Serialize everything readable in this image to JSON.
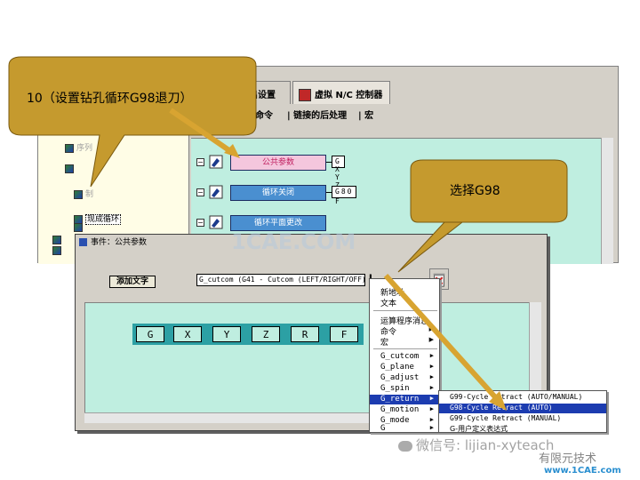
{
  "callouts": {
    "step": "10（设置钻孔循环G98退刀）",
    "select": "选择G98"
  },
  "back_window": {
    "tabs": [
      "出设置",
      "虚拟 N/C 控制器"
    ],
    "subtabs": [
      "命令",
      "链接的后处理",
      "宏"
    ],
    "tree": {
      "items": [
        {
          "label": "序列",
          "faded": true
        },
        {
          "label": "序列",
          "faded": true
        },
        {
          "label": "",
          "faded": true
        },
        {
          "label": "制",
          "faded": true
        },
        {
          "label": "现成循环",
          "faded": false,
          "selected": true
        },
        {
          "label": "",
          "faded": true
        }
      ]
    },
    "blocks": [
      {
        "label": "公共参数",
        "style": "pink",
        "value": "G X Y Z R F"
      },
      {
        "label": "循环关闭",
        "style": "blue",
        "value": "G80"
      },
      {
        "label": "循环平面更改",
        "style": "blue",
        "value": ""
      }
    ]
  },
  "dialog": {
    "title": "事件：公共参数",
    "add_text_button": "添加文字",
    "command_select": "G_cutcom (G41 - Cutcom (LEFT/RIGHT/OFF))",
    "words": [
      "G",
      "X",
      "Y",
      "Z",
      "R",
      "F"
    ]
  },
  "context_menu": {
    "items": [
      {
        "label": "新地址",
        "submenu": false
      },
      {
        "label": "文本",
        "submenu": false
      },
      {
        "label": "运算程序消息",
        "submenu": false
      },
      {
        "label": "命令",
        "submenu": true
      },
      {
        "label": "宏",
        "submenu": true
      },
      {
        "label": "G_cutcom",
        "submenu": true
      },
      {
        "label": "G_plane",
        "submenu": true
      },
      {
        "label": "G_adjust",
        "submenu": true
      },
      {
        "label": "G_spin",
        "submenu": true
      },
      {
        "label": "G_return",
        "submenu": true,
        "highlighted": true
      },
      {
        "label": "G_motion",
        "submenu": true
      },
      {
        "label": "G_mode",
        "submenu": true
      },
      {
        "label": "G",
        "submenu": true
      }
    ],
    "submenu_items": [
      {
        "label": "G99-Cycle Retract (AUTO/MANUAL)"
      },
      {
        "label": "G98-Cycle Retract (AUTO)",
        "highlighted": true
      },
      {
        "label": "G99-Cycle Retract (MANUAL)"
      },
      {
        "label": "G-用户定义表达式"
      }
    ]
  },
  "watermarks": {
    "center": "1CAE.COM",
    "wechat": "微信号: lijian-xyteach",
    "brand": "有限元技术",
    "site": "www.1CAE.com"
  },
  "colors": {
    "callout_fill": "#c59a2e",
    "arrow": "#d8a431",
    "highlight": "#1c3cb0",
    "canvas": "#bfeee0"
  }
}
